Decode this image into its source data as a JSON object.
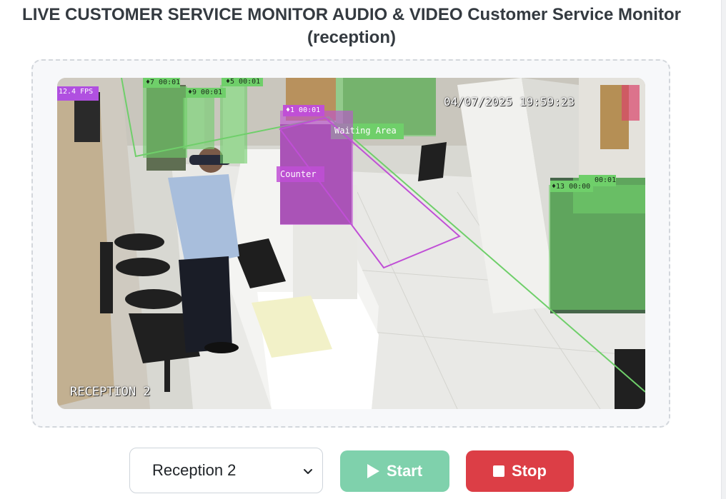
{
  "page": {
    "title": "LIVE CUSTOMER SERVICE MONITOR AUDIO & VIDEO Customer Service Monitor (reception)"
  },
  "video": {
    "fps_label": "12.4 FPS",
    "timestamp": "04/07/2025 19:59:23",
    "camera_name": "RECEPTION 2",
    "zones": {
      "waiting": "Waiting Area",
      "counter": "Counter"
    },
    "tracks": [
      {
        "label": "♦7 00:01",
        "zone": "waiting"
      },
      {
        "label": "♦9 00:01",
        "zone": "waiting"
      },
      {
        "label": "♦5 00:01",
        "zone": "waiting"
      },
      {
        "label": "♦1 00:01",
        "zone": "counter"
      },
      {
        "label": "♦13 00:00",
        "zone": "waiting"
      },
      {
        "label": "00:01",
        "zone": "waiting"
      }
    ],
    "colors": {
      "waiting": "#6fcf6a",
      "counter": "#c04fd6",
      "fps_badge": "#b050e0"
    }
  },
  "controls": {
    "camera_select": {
      "selected": "Reception 2"
    },
    "start_label": "Start",
    "stop_label": "Stop"
  },
  "colors": {
    "start_button": "#7fd1ac",
    "stop_button": "#dc3e46"
  }
}
